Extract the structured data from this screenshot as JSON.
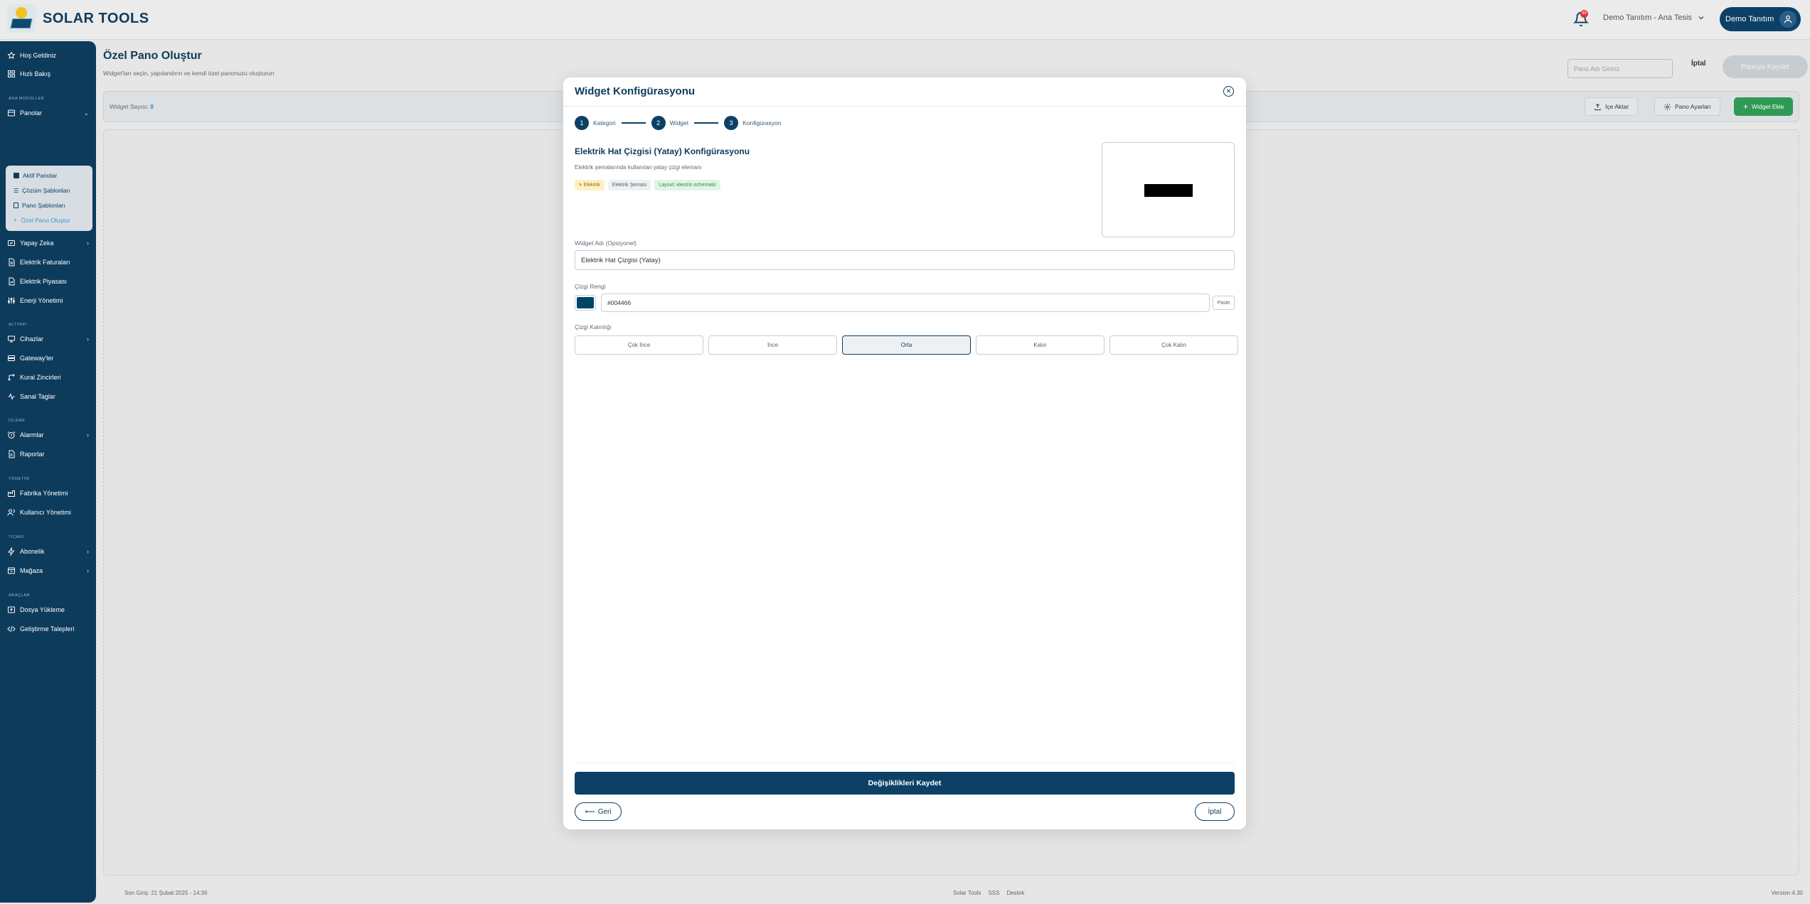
{
  "app": {
    "name": "SOLAR TOOLS"
  },
  "topbar": {
    "notification_count": "99",
    "org_select": "Demo Tanıtım - Ana Tesis",
    "user_name": "Demo Tanıtım"
  },
  "sidebar": {
    "items": [
      {
        "label": "Hoş Geldiniz",
        "icon": "star-icon"
      },
      {
        "label": "Hızlı Bakış",
        "icon": "grid-icon"
      },
      {
        "label": "Panolar",
        "icon": "dashboard-icon"
      },
      {
        "label": "Yapay Zeka",
        "icon": "ai-icon"
      },
      {
        "label": "Elektrik Faturaları",
        "icon": "invoice-icon"
      },
      {
        "label": "Elektrik Piyasası",
        "icon": "market-icon"
      },
      {
        "label": "Enerji Yönetimi",
        "icon": "sliders-icon"
      },
      {
        "label": "Cihazlar",
        "icon": "monitor-icon"
      },
      {
        "label": "Gateway'ler",
        "icon": "gateway-icon"
      },
      {
        "label": "Kural Zincirleri",
        "icon": "chain-icon"
      },
      {
        "label": "Sanal Taglar",
        "icon": "pulse-icon"
      },
      {
        "label": "Alarmlar",
        "icon": "alarm-icon"
      },
      {
        "label": "Raporlar",
        "icon": "report-icon"
      },
      {
        "label": "Fabrika Yönetimi",
        "icon": "factory-icon"
      },
      {
        "label": "Kullanıcı Yönetimi",
        "icon": "users-icon"
      },
      {
        "label": "Abonelik",
        "icon": "bolt-icon"
      },
      {
        "label": "Mağaza",
        "icon": "store-icon"
      },
      {
        "label": "Dosya Yükleme",
        "icon": "upload-icon"
      },
      {
        "label": "Geliştirme Talepleri",
        "icon": "code-icon"
      }
    ],
    "sections": [
      "ANA MODÜLLER",
      "ALTYAPI",
      "İZLEME",
      "YÖNETİM",
      "TİCARİ",
      "ARAÇLAR"
    ],
    "submenu": [
      {
        "label": "Aktif Panolar"
      },
      {
        "label": "Çözüm Şablonları"
      },
      {
        "label": "Pano Şablonları"
      },
      {
        "label": "Özel Pano Oluştur"
      }
    ]
  },
  "page": {
    "title": "Özel Pano Oluştur",
    "subtitle": "Widget'ları seçin, yapılandırın ve kendi özel panonuzu oluşturun",
    "name_placeholder": "Pano Adı Giriniz",
    "cancel_label": "İptal",
    "save_label": "Panoyu Kaydet",
    "widget_count_label": "Widget Sayısı:",
    "widget_count": "0",
    "import_label": "İçe Aktar",
    "settings_label": "Pano Ayarları",
    "add_widget_label": "Widget Ekle"
  },
  "footer": {
    "last_login": "Son Giriş: 21 Şubat 2025 - 14:36",
    "brand": "Solar Tools",
    "faq": "SSS",
    "support": "Destek",
    "version": "Version 4.30"
  },
  "modal": {
    "title": "Widget Konfigürasyonu",
    "steps": [
      {
        "num": "1",
        "label": "Kategori"
      },
      {
        "num": "2",
        "label": "Widget"
      },
      {
        "num": "3",
        "label": "Konfigürasyon"
      }
    ],
    "config_title": "Elektrik Hat Çizgisi (Yatay) Konfigürasyonu",
    "config_desc": "Elektrik şemalarında kullanılan yatay çizgi elemanı",
    "tags": [
      "Elektrik",
      "Elektrik Şeması",
      "Layout: electric-schematic"
    ],
    "widget_name_label": "Widget Adı (Opsiyonel)",
    "widget_name_value": "Elektrik Hat Çizgisi (Yatay)",
    "line_color_label": "Çizgi Rengi",
    "line_color_value": "#004466",
    "paste_label": "Paste",
    "thickness_label": "Çizgi Kalınlığı",
    "thickness_options": [
      "Çok İnce",
      "İnce",
      "Orta",
      "Kalın",
      "Çok Kalın"
    ],
    "thickness_selected": "Orta",
    "save_changes_label": "Değişiklikleri Kaydet",
    "back_label": "Geri",
    "cancel_label": "İptal"
  },
  "colors": {
    "primary": "#0d4066",
    "sidebar": "#0d3b5c",
    "accent_green": "#2f9a55",
    "line_color": "#004466"
  }
}
